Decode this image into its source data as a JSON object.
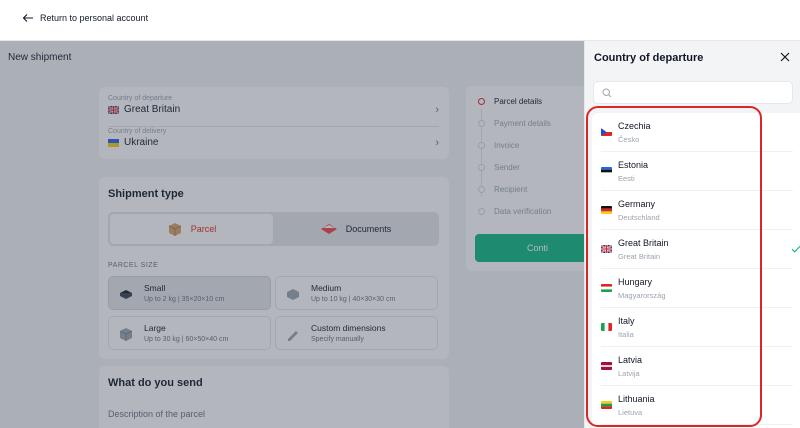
{
  "topbar": {
    "back_label": "Return to personal account"
  },
  "page": {
    "title": "New shipment",
    "route": {
      "departure_label": "Country of departure",
      "departure_value": "Great Britain",
      "delivery_label": "Country of delivery",
      "delivery_value": "Ukraine"
    },
    "shipment_type": {
      "title": "Shipment type",
      "options": [
        "Parcel",
        "Documents"
      ],
      "selected": "Parcel",
      "size_caption": "PARCEL SIZE",
      "sizes": [
        {
          "name": "Small",
          "desc": "Up to 2 kg | 35×20×10 cm",
          "selected": true
        },
        {
          "name": "Medium",
          "desc": "Up to 10 kg | 40×30×30 cm"
        },
        {
          "name": "Large",
          "desc": "Up to 30 kg | 60×50×40 cm"
        },
        {
          "name": "Custom dimensions",
          "desc": "Specify manually"
        }
      ]
    },
    "send": {
      "title": "What do you send",
      "description_label": "Description of the parcel"
    },
    "steps": [
      "Parcel details",
      "Payment details",
      "Invoice",
      "Sender",
      "Recipient",
      "Data verification"
    ],
    "current_step": "Parcel details",
    "continue_label": "Conti"
  },
  "drawer": {
    "title": "Country of departure",
    "search_placeholder": "",
    "selected": "Great Britain",
    "countries": [
      {
        "name": "Czechia",
        "native": "Česko",
        "flag": "cz"
      },
      {
        "name": "Estonia",
        "native": "Eesti",
        "flag": "ee"
      },
      {
        "name": "Germany",
        "native": "Deutschland",
        "flag": "de"
      },
      {
        "name": "Great Britain",
        "native": "Great Britain",
        "flag": "gb"
      },
      {
        "name": "Hungary",
        "native": "Magyarország",
        "flag": "hu"
      },
      {
        "name": "Italy",
        "native": "Italia",
        "flag": "it"
      },
      {
        "name": "Latvia",
        "native": "Latvija",
        "flag": "lv"
      },
      {
        "name": "Lithuania",
        "native": "Lietuva",
        "flag": "lt"
      }
    ]
  },
  "colors": {
    "accent": "#dc2626",
    "success": "#10b981",
    "check": "#10b981"
  }
}
